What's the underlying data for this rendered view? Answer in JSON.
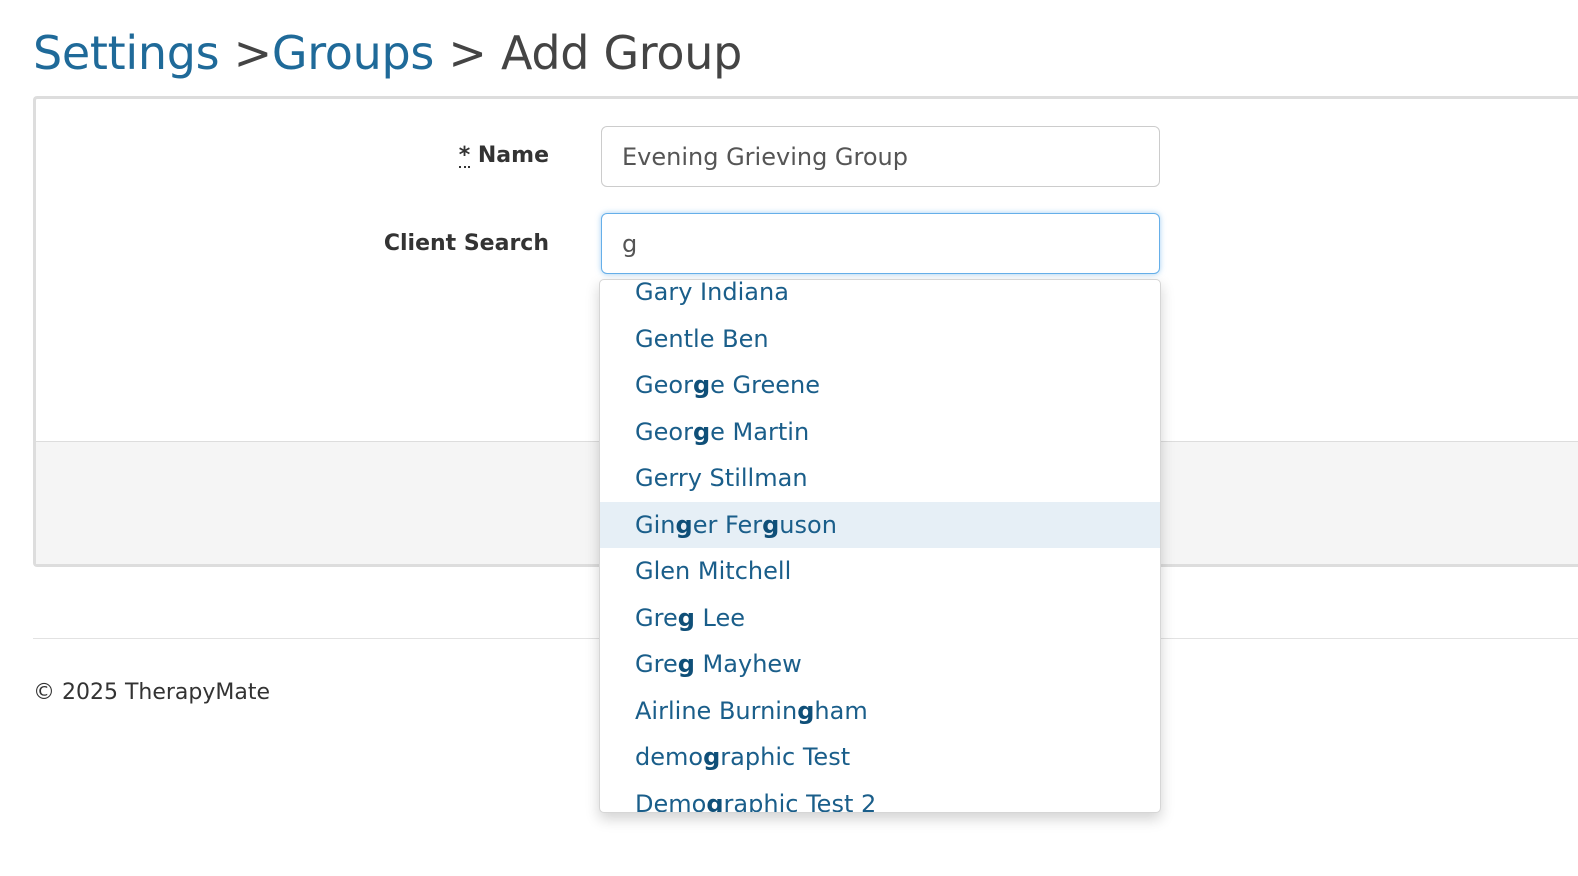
{
  "breadcrumb": {
    "settings": "Settings",
    "sep1": " >",
    "groups": "Groups",
    "sep2": " > ",
    "current": "Add Group"
  },
  "form": {
    "name_required_marker": "*",
    "name_label": " Name",
    "name_value": "Evening Grieving Group",
    "client_search_label": "Client Search",
    "client_search_value": "g"
  },
  "dropdown": {
    "query": "g",
    "highlighted_index": 5,
    "items": [
      "Gary Indiana",
      "Gentle Ben",
      "George Greene",
      "George Martin",
      "Gerry Stillman",
      "Ginger Ferguson",
      "Glen Mitchell",
      "Greg Lee",
      "Greg Mayhew",
      "Airline Burningham",
      "demographic Test",
      "Demographic Test 2"
    ]
  },
  "footer": {
    "copyright": "© 2025 TherapyMate"
  },
  "colors": {
    "link": "#1f6a99",
    "dropdown_text": "#1a5e8a",
    "highlight_bg": "#e6eff6",
    "focus_border": "#66afe9"
  }
}
